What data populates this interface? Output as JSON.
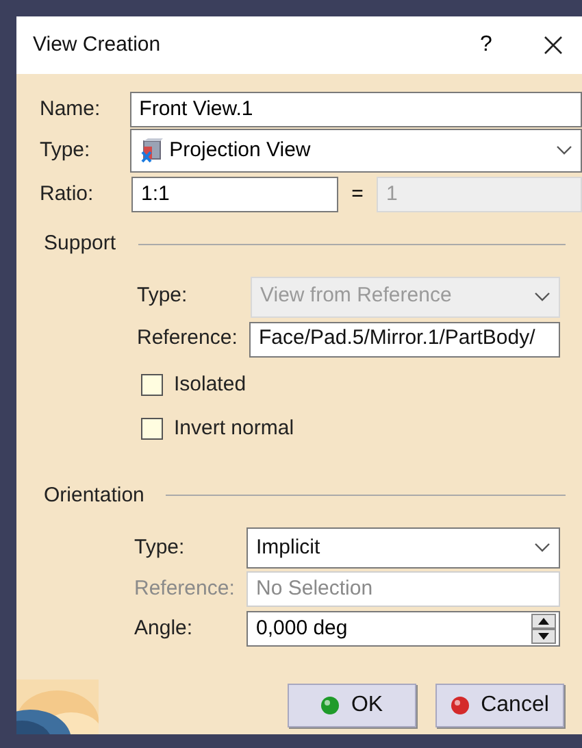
{
  "window": {
    "title": "View Creation",
    "help": "?"
  },
  "name": {
    "label": "Name:",
    "value": "Front View.1"
  },
  "type": {
    "label": "Type:",
    "value": "Projection View"
  },
  "ratio": {
    "label": "Ratio:",
    "value": "1:1",
    "equals": "=",
    "result": "1",
    "result_disabled": true
  },
  "support": {
    "title": "Support",
    "type": {
      "label": "Type:",
      "value": "View from Reference",
      "disabled": true
    },
    "reference": {
      "label": "Reference:",
      "value": "Face/Pad.5/Mirror.1/PartBody/",
      "disabled": false
    },
    "checkboxes": [
      {
        "label": "Isolated",
        "checked": false
      },
      {
        "label": "Invert normal",
        "checked": false
      }
    ]
  },
  "orientation": {
    "title": "Orientation",
    "type": {
      "label": "Type:",
      "value": "Implicit",
      "disabled": false
    },
    "reference": {
      "label": "Reference:",
      "value": "No Selection",
      "disabled": true
    },
    "angle": {
      "label": "Angle:",
      "value": "0,000 deg"
    }
  },
  "buttons": [
    {
      "label": "OK",
      "kind": "ok"
    },
    {
      "label": "Cancel",
      "kind": "cancel"
    }
  ]
}
